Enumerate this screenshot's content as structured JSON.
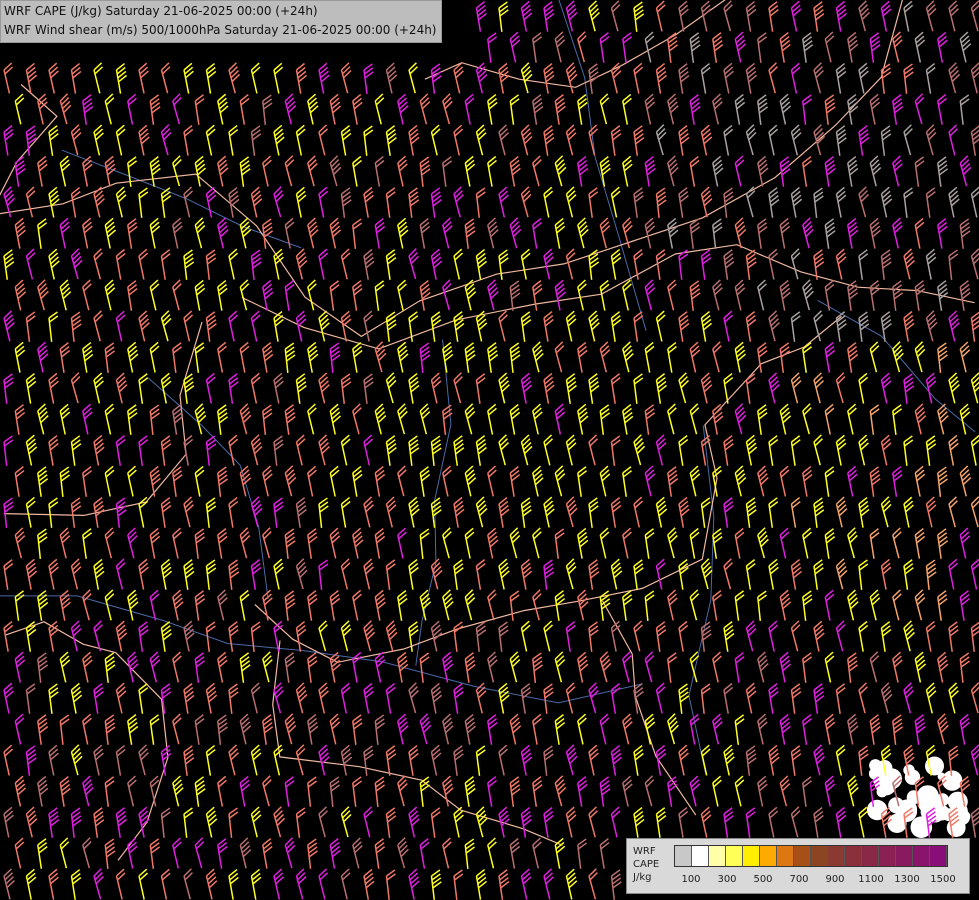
{
  "titles": {
    "line1": "WRF CAPE (J/kg) Saturday 21-06-2025 00:00 (+24h)",
    "line2": "WRF Wind shear (m/s) 500/1000hPa Saturday 21-06-2025 00:00 (+24h)"
  },
  "legend": {
    "label_lines": [
      "WRF",
      "CAPE",
      "J/kg"
    ],
    "colors": [
      "#c8c8c8",
      "#ffffff",
      "#ffffaa",
      "#ffff55",
      "#ffee00",
      "#ffaa00",
      "#dd7711",
      "#a65018",
      "#8c4422",
      "#8a3a32",
      "#8a2f3c",
      "#8a2848",
      "#8a2054",
      "#8a1a60",
      "#8a146c",
      "#8a0e78"
    ],
    "tick_labels": [
      "100",
      "300",
      "500",
      "700",
      "900",
      "1100",
      "1300",
      "1500"
    ]
  },
  "map_style": {
    "background": "#000000",
    "border_color": "#f0b8a0",
    "river_color": "#4a6aa8",
    "barb_colors": [
      "#ffff22",
      "#f07868",
      "#e020e0",
      "#b86f6f",
      "#aaa0a0",
      "#f4a46a"
    ],
    "cape_patch_color": "#ffffff"
  }
}
